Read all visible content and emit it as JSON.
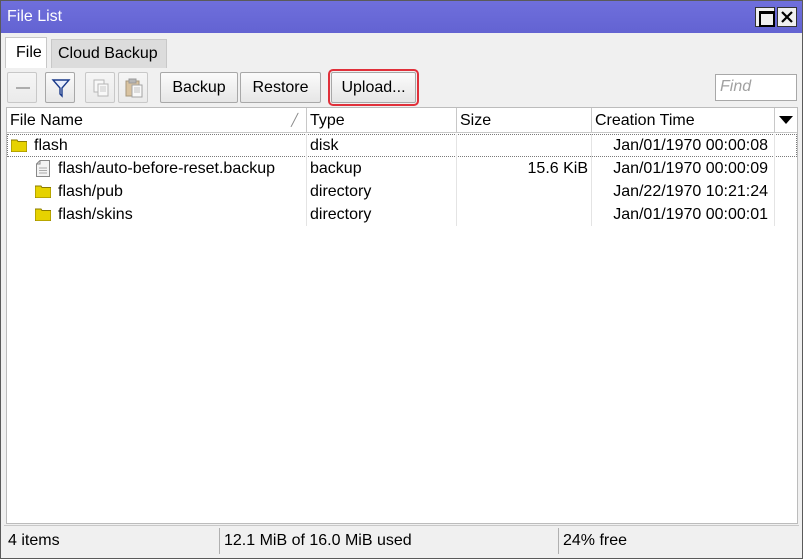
{
  "window": {
    "title": "File List"
  },
  "tabs": [
    {
      "label": "File",
      "active": true
    },
    {
      "label": "Cloud Backup",
      "active": false
    }
  ],
  "toolbar": {
    "remove_icon": "minus-icon",
    "filter_icon": "filter-icon",
    "copy_icon": "copy-icon",
    "paste_icon": "paste-icon",
    "backup_label": "Backup",
    "restore_label": "Restore",
    "upload_label": "Upload...",
    "find_placeholder": "Find"
  },
  "table": {
    "columns": [
      "File Name",
      "Type",
      "Size",
      "Creation Time"
    ],
    "rows": [
      {
        "name": "flash",
        "type": "disk",
        "size": "",
        "created": "Jan/01/1970 00:00:08",
        "icon": "folder-icon"
      },
      {
        "name": "flash/auto-before-reset.backup",
        "type": "backup",
        "size": "15.6 KiB",
        "created": "Jan/01/1970 00:00:09",
        "icon": "file-icon"
      },
      {
        "name": "flash/pub",
        "type": "directory",
        "size": "",
        "created": "Jan/22/1970 10:21:24",
        "icon": "folder-icon"
      },
      {
        "name": "flash/skins",
        "type": "directory",
        "size": "",
        "created": "Jan/01/1970 00:00:01",
        "icon": "folder-icon"
      }
    ]
  },
  "status": {
    "items": "4 items",
    "usage": "12.1 MiB of 16.0 MiB used",
    "free": "24% free"
  },
  "colors": {
    "titlebar": "#6a6ad8",
    "highlight_border": "#e0303a",
    "folder": "#e6d200"
  }
}
